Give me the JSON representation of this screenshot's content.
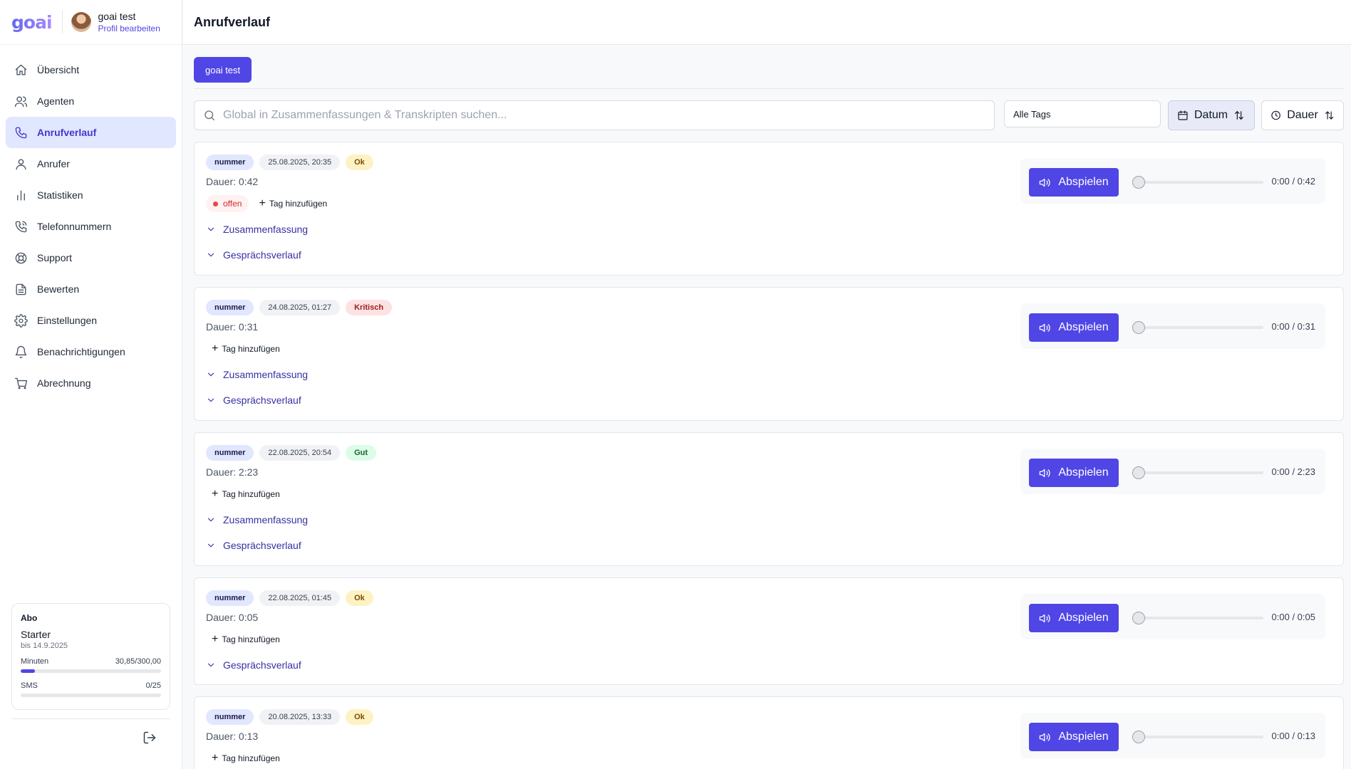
{
  "app": {
    "logo": "goai",
    "user_name": "goai test",
    "profile_link": "Profil bearbeiten"
  },
  "sidebar": {
    "items": [
      {
        "label": "Übersicht",
        "icon": "home-icon",
        "active": false
      },
      {
        "label": "Agenten",
        "icon": "users-icon",
        "active": false
      },
      {
        "label": "Anrufverlauf",
        "icon": "phone-icon",
        "active": true
      },
      {
        "label": "Anrufer",
        "icon": "user-icon",
        "active": false
      },
      {
        "label": "Statistiken",
        "icon": "bar-chart-icon",
        "active": false
      },
      {
        "label": "Telefonnummern",
        "icon": "phone-call-icon",
        "active": false
      },
      {
        "label": "Support",
        "icon": "lifebuoy-icon",
        "active": false
      },
      {
        "label": "Bewerten",
        "icon": "file-text-icon",
        "active": false
      },
      {
        "label": "Einstellungen",
        "icon": "gear-icon",
        "active": false
      },
      {
        "label": "Benachrichtigungen",
        "icon": "bell-icon",
        "active": false
      },
      {
        "label": "Abrechnung",
        "icon": "cart-icon",
        "active": false
      }
    ],
    "abo": {
      "heading": "Abo",
      "plan": "Starter",
      "until": "bis 14.9.2025",
      "minutes_label": "Minuten",
      "minutes_value": "30,85/300,00",
      "minutes_progress": 0.103,
      "sms_label": "SMS",
      "sms_value": "0/25",
      "sms_progress": 0
    }
  },
  "page": {
    "title": "Anrufverlauf",
    "agent_tab": "goai test",
    "search_placeholder": "Global in Zusammenfassungen & Transkripten suchen...",
    "tags_filter": "Alle Tags",
    "sort_date": "Datum",
    "sort_duration": "Dauer"
  },
  "labels": {
    "add_tag": "Tag hinzufügen",
    "summary": "Zusammenfassung",
    "transcript": "Gesprächsverlauf",
    "play": "Abspielen"
  },
  "colors": {
    "accent": "#4f46e5",
    "active_nav_bg": "#e0e7ff"
  },
  "calls": [
    {
      "number": "nummer",
      "date": "25.08.2025, 20:35",
      "quality": "Ok",
      "duration": "Dauer: 0:42",
      "status_tag": "offen",
      "time": "0:00 / 0:42",
      "summary": true
    },
    {
      "number": "nummer",
      "date": "24.08.2025, 01:27",
      "quality": "Kritisch",
      "duration": "Dauer: 0:31",
      "status_tag": "",
      "time": "0:00 / 0:31",
      "summary": true
    },
    {
      "number": "nummer",
      "date": "22.08.2025, 20:54",
      "quality": "Gut",
      "duration": "Dauer: 2:23",
      "status_tag": "",
      "time": "0:00 / 2:23",
      "summary": true
    },
    {
      "number": "nummer",
      "date": "22.08.2025, 01:45",
      "quality": "Ok",
      "duration": "Dauer: 0:05",
      "status_tag": "",
      "time": "0:00 / 0:05",
      "summary": false
    },
    {
      "number": "nummer",
      "date": "20.08.2025, 13:33",
      "quality": "Ok",
      "duration": "Dauer: 0:13",
      "status_tag": "",
      "time": "0:00 / 0:13",
      "summary": false
    }
  ]
}
